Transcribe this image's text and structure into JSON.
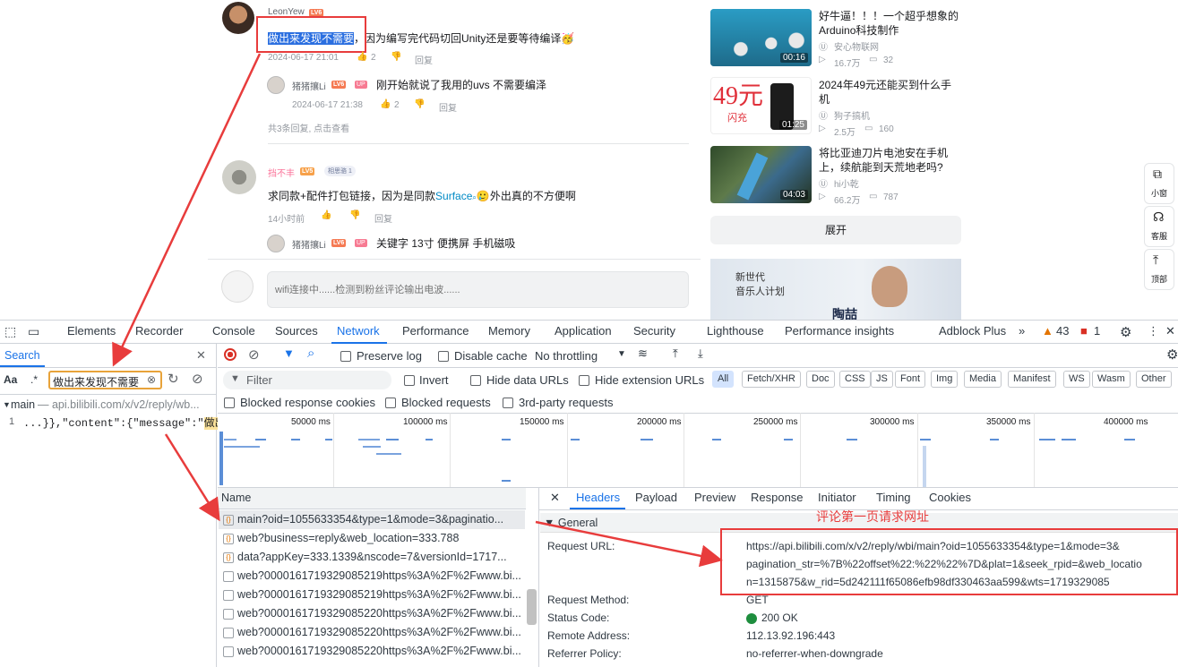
{
  "comments": [
    {
      "user": "LeonYew",
      "level": "LV6",
      "text_highlight": "做出来发现不需要",
      "text_rest": "，因为编写完代码切回Unity还是要等待编译",
      "emoji": "🥳",
      "time": "2024-06-17 21:01",
      "likes": "2",
      "reply": "回复"
    },
    {
      "user": "猪猪攘Li",
      "level": "LV6",
      "up": "UP",
      "text": "刚开始就说了我用的uvs 不需要编泽",
      "time": "2024-06-17 21:38",
      "likes": "2",
      "reply": "回复"
    },
    {
      "summary": "共3条回复, 点击查看"
    },
    {
      "user": "挡不丰",
      "level": "LV5",
      "badge": "相思骆 1",
      "text_a": "求同款+配件打包链接，因为是同款",
      "link": "Surface",
      "text_b": "外出真的不方便啊",
      "time": "14小时前",
      "reply": "回复"
    },
    {
      "user": "猪猪攘Li",
      "level": "LV6",
      "up": "UP",
      "text": "关键字 13寸 便携屏 手机磁吸"
    }
  ],
  "reply_input": {
    "placeholder": "wifi连接中......检测到粉丝评论输出电波......"
  },
  "videos": [
    {
      "title": "好牛逼！！！一个超乎想象的Arduino科技制作",
      "author": "安心物联网",
      "views": "16.7万",
      "danmaku": "32",
      "duration": "00:16"
    },
    {
      "title": "2024年49元还能买到什么手机",
      "author": "狗子搞机",
      "views": "2.5万",
      "danmaku": "160",
      "duration": "01:25",
      "thumb_text": "49元",
      "thumb_sub": "闪充"
    },
    {
      "title": "将比亚迪刀片电池安在手机上，续航能到天荒地老吗?",
      "author": "hi小乾",
      "views": "66.2万",
      "danmaku": "787",
      "duration": "04:03"
    }
  ],
  "expand_label": "展开",
  "banner": {
    "line1": "新世代",
    "line2": "音乐人计划",
    "name": "陶喆"
  },
  "side_buttons": [
    "小窗",
    "客服",
    "顶部"
  ],
  "devtools": {
    "tabs": [
      "Elements",
      "Recorder",
      "Console",
      "Sources",
      "Network",
      "Performance",
      "Memory",
      "Application",
      "Security",
      "Lighthouse",
      "Performance insights",
      "Adblock Plus"
    ],
    "more": "»",
    "warn_count": "43",
    "err_count": "1",
    "search": {
      "title": "Search",
      "case": "Aa",
      "regex": ".*",
      "query": "做出来发现不需要",
      "result_file": "main",
      "result_url": "— api.bilibili.com/x/v2/reply/wb...",
      "result_line": "1",
      "result_text": "...}},\"content\":{\"message\":\"",
      "result_match": "做出来发..."
    },
    "toolbar": {
      "preserve_log": "Preserve log",
      "disable_cache": "Disable cache",
      "throttling": "No throttling"
    },
    "filter": {
      "placeholder": "Filter",
      "invert": "Invert",
      "hide_data": "Hide data URLs",
      "hide_ext": "Hide extension URLs"
    },
    "types": [
      "All",
      "Fetch/XHR",
      "Doc",
      "CSS",
      "JS",
      "Font",
      "Img",
      "Media",
      "Manifest",
      "WS",
      "Wasm",
      "Other"
    ],
    "blocked": [
      "Blocked response cookies",
      "Blocked requests",
      "3rd-party requests"
    ],
    "timeline_ticks": [
      "50000 ms",
      "100000 ms",
      "150000 ms",
      "200000 ms",
      "250000 ms",
      "300000 ms",
      "350000 ms",
      "400000 ms"
    ],
    "name_header": "Name",
    "requests": [
      "main?oid=1055633354&type=1&mode=3&paginatio...",
      "web?business=reply&web_location=333.788",
      "data?appKey=333.1339&nscode=7&versionId=1717...",
      "web?000016171932908521​9https%3A%2F%2Fwww.bi...",
      "web?0000161719329085219https%3A%2F%2Fwww.bi...",
      "web?0000161719329085220https%3A%2F%2Fwww.bi...",
      "web?0000161719329085220https%3A%2F%2Fwww.bi...",
      "web?0000161719329085220https%3A%2F%2Fwww.bi..."
    ],
    "detail_tabs": [
      "Headers",
      "Payload",
      "Preview",
      "Response",
      "Initiator",
      "Timing",
      "Cookies"
    ],
    "general": "▼ General",
    "annotation": "评论第一页请求网址",
    "headers": [
      {
        "k": "Request URL:",
        "v1": "https://api.bilibili.com/x/v2/reply/wbi/main?oid=1055633354&type=1&mode=3&",
        "v2": "pagination_str=%7B%22offset%22:%22%22%7D&plat=1&seek_rpid=&web_locatio",
        "v3": "n=1315875&w_rid=5d242111f65086efb98df330463aa599&wts=1719329085"
      },
      {
        "k": "Request Method:",
        "v": "GET"
      },
      {
        "k": "Status Code:",
        "v": "200 OK"
      },
      {
        "k": "Remote Address:",
        "v": "112.13.92.196:443"
      },
      {
        "k": "Referrer Policy:",
        "v": "no-referrer-when-downgrade"
      }
    ]
  }
}
